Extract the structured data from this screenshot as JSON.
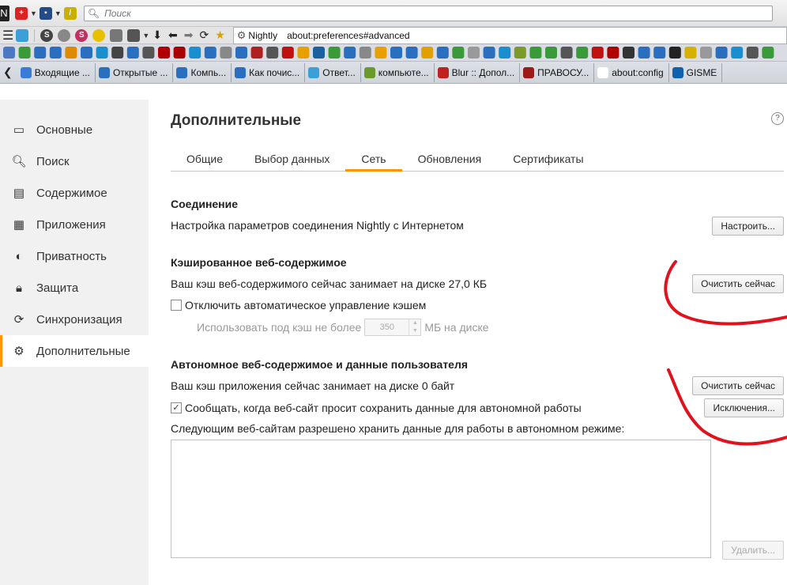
{
  "toolbar": {
    "logo": "N",
    "search_placeholder": "Поиск",
    "site_identity": "Nightly",
    "url": "about:preferences#advanced"
  },
  "tabs": [
    {
      "label": "Входящие ..."
    },
    {
      "label": "Открытые ..."
    },
    {
      "label": "Компь..."
    },
    {
      "label": "Как почис..."
    },
    {
      "label": "Ответ..."
    },
    {
      "label": "компьюте..."
    },
    {
      "label": "Blur :: Допол..."
    },
    {
      "label": "ПРАВОСУ..."
    },
    {
      "label": "about:config"
    },
    {
      "label": "GISME"
    }
  ],
  "sidebar": {
    "items": [
      {
        "label": "Основные",
        "icon": "general-icon"
      },
      {
        "label": "Поиск",
        "icon": "search-icon"
      },
      {
        "label": "Содержимое",
        "icon": "content-icon"
      },
      {
        "label": "Приложения",
        "icon": "applications-icon"
      },
      {
        "label": "Приватность",
        "icon": "privacy-mask-icon"
      },
      {
        "label": "Защита",
        "icon": "lock-icon"
      },
      {
        "label": "Синхронизация",
        "icon": "sync-icon"
      },
      {
        "label": "Дополнительные",
        "icon": "gear-icon"
      }
    ],
    "selected_index": 7
  },
  "page": {
    "title": "Дополнительные",
    "help": "?",
    "tabs": [
      {
        "label": "Общие"
      },
      {
        "label": "Выбор данных"
      },
      {
        "label": "Сеть"
      },
      {
        "label": "Обновления"
      },
      {
        "label": "Сертификаты"
      }
    ],
    "selected_tab": 2
  },
  "connection": {
    "title": "Соединение",
    "desc": "Настройка параметров соединения Nightly с Интернетом",
    "button": "Настроить..."
  },
  "cache": {
    "title": "Кэшированное веб-содержимое",
    "desc": "Ваш кэш веб-содержимого сейчас занимает на диске 27,0 КБ",
    "button": "Очистить сейчас",
    "override_label": "Отключить автоматическое управление кэшем",
    "override_checked": false,
    "limit_prefix": "Использовать под кэш не более",
    "limit_value": "350",
    "limit_suffix": "МБ на диске"
  },
  "offline": {
    "title": "Автономное веб-содержимое и данные пользователя",
    "desc": "Ваш кэш приложения сейчас занимает на диске 0 байт",
    "button": "Очистить сейчас",
    "notify_label": "Сообщать, когда веб-сайт просит сохранить данные для автономной работы",
    "notify_checked": true,
    "exceptions_button": "Исключения...",
    "list_label": "Следующим веб-сайтам разрешено хранить данные для работы в автономном режиме:",
    "remove_button": "Удалить..."
  },
  "colors": {
    "accent": "#ff9500",
    "annotation": "#e0121e"
  }
}
